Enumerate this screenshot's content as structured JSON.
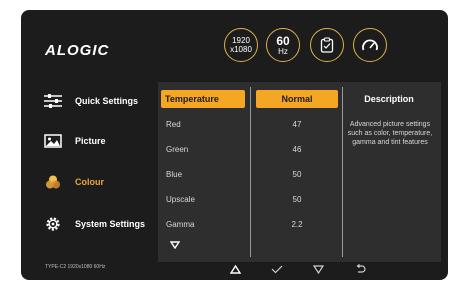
{
  "brand": {
    "logo": "ALOGIC"
  },
  "status": {
    "resolution_line1": "1920",
    "resolution_line2": "x1080",
    "refresh_value": "60",
    "refresh_unit": "Hz",
    "footer": "TYPE-C2   1920x1080 60Hz"
  },
  "sidebar": {
    "items": [
      {
        "label": "Quick Settings",
        "icon": "sliders-icon",
        "active": false
      },
      {
        "label": "Picture",
        "icon": "image-icon",
        "active": false
      },
      {
        "label": "Colour",
        "icon": "color-circles-icon",
        "active": true
      },
      {
        "label": "System Settings",
        "icon": "gear-icon",
        "active": false
      }
    ]
  },
  "panel": {
    "selected_item": "Temperature",
    "selected_value": "Normal",
    "description_title": "Description",
    "description_text": "Advanced picture settings such as color, temperature, gamma and tint features",
    "rows": [
      {
        "label": "Red",
        "value": "47"
      },
      {
        "label": "Green",
        "value": "46"
      },
      {
        "label": "Blue",
        "value": "50"
      },
      {
        "label": "Upscale",
        "value": "50"
      },
      {
        "label": "Gamma",
        "value": "2.2"
      }
    ]
  },
  "nav_buttons": [
    "up-icon",
    "check-icon",
    "down-icon",
    "back-icon"
  ],
  "colors": {
    "accent": "#f5a623",
    "gold": "#d9b24a",
    "background": "#1c1c1c",
    "panel": "#2e2e2e"
  }
}
